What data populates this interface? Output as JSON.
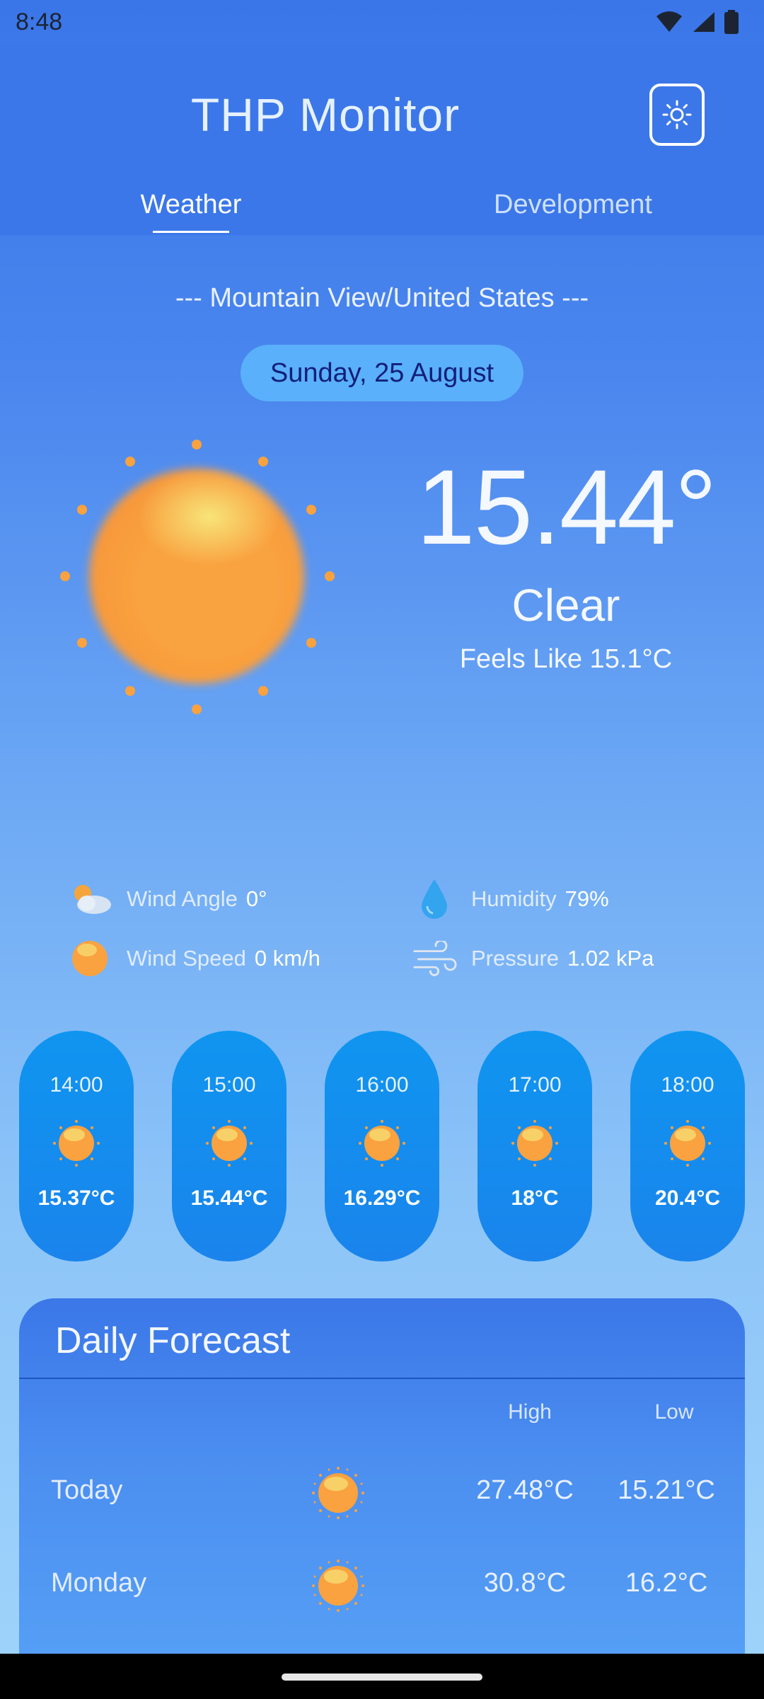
{
  "status_bar": {
    "time": "8:48"
  },
  "app_bar": {
    "title": "THP Monitor",
    "tabs": [
      {
        "label": "Weather",
        "selected": true
      },
      {
        "label": "Development",
        "selected": false
      }
    ]
  },
  "current": {
    "location": "--- Mountain View/United States ---",
    "date": "Sunday, 25 August",
    "temperature": "15.44°",
    "condition": "Clear",
    "feels_like": "Feels Like 15.1°C",
    "icon": "sun-icon"
  },
  "details": [
    {
      "label": "Wind Angle",
      "value": "0°",
      "icon": "cloud-sun-icon"
    },
    {
      "label": "Humidity",
      "value": "79%",
      "icon": "water-drop-icon"
    },
    {
      "label": "Wind Speed",
      "value": "0 km/h",
      "icon": "sun-orb-icon"
    },
    {
      "label": "Pressure",
      "value": "1.02 kPa",
      "icon": "wind-icon"
    }
  ],
  "hourly": [
    {
      "time": "14:00",
      "temp": "15.37°C",
      "icon": "sun-icon"
    },
    {
      "time": "15:00",
      "temp": "15.44°C",
      "icon": "sun-icon"
    },
    {
      "time": "16:00",
      "temp": "16.29°C",
      "icon": "sun-icon"
    },
    {
      "time": "17:00",
      "temp": "18°C",
      "icon": "sun-icon"
    },
    {
      "time": "18:00",
      "temp": "20.4°C",
      "icon": "sun-icon"
    }
  ],
  "daily": {
    "title": "Daily Forecast",
    "high_label": "High",
    "low_label": "Low",
    "rows": [
      {
        "day": "Today",
        "high": "27.48°C",
        "low": "15.21°C",
        "icon": "sun-icon"
      },
      {
        "day": "Monday",
        "high": "30.8°C",
        "low": "16.2°C",
        "icon": "sun-icon"
      }
    ]
  },
  "colors": {
    "app_bar": "#3b77e8",
    "date_pill": "#5ab0fa",
    "hour_card": "#1a84ec",
    "sun_orange": "#f9a23f",
    "sun_highlight": "#f8e070"
  }
}
